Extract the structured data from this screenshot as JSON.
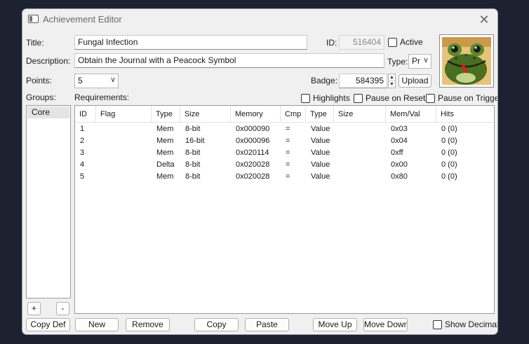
{
  "window": {
    "title": "Achievement Editor",
    "close_glyph": "✕"
  },
  "fields": {
    "title_label": "Title:",
    "title_value": "Fungal Infection",
    "id_label": "ID:",
    "id_value": "516404",
    "active_label": "Active",
    "description_label": "Description:",
    "description_value": "Obtain the Journal with a Peacock Symbol",
    "type_label": "Type:",
    "type_value": "Pr",
    "points_label": "Points:",
    "points_value": "5",
    "badge_label": "Badge:",
    "badge_value": "584395",
    "upload_label": "Upload"
  },
  "groups": {
    "label": "Groups:",
    "items": [
      "Core"
    ],
    "add_label": "+",
    "remove_label": "-"
  },
  "requirements": {
    "label": "Requirements:",
    "highlights_label": "Highlights",
    "pause_on_reset_label": "Pause on Reset",
    "pause_on_trigger_label": "Pause on Trigger",
    "columns": [
      "ID",
      "Flag",
      "Type",
      "Size",
      "Memory",
      "Cmp",
      "Type",
      "Size",
      "Mem/Val",
      "Hits"
    ],
    "rows": [
      [
        "1",
        "",
        "Mem",
        "8-bit",
        "0x000090",
        "=",
        "Value",
        "",
        "0x03",
        "0 (0)"
      ],
      [
        "2",
        "",
        "Mem",
        "16-bit",
        "0x000096",
        "=",
        "Value",
        "",
        "0x04",
        "0 (0)"
      ],
      [
        "3",
        "",
        "Mem",
        "8-bit",
        "0x020114",
        "=",
        "Value",
        "",
        "0xff",
        "0 (0)"
      ],
      [
        "4",
        "",
        "Delta",
        "8-bit",
        "0x020028",
        "=",
        "Value",
        "",
        "0x00",
        "0 (0)"
      ],
      [
        "5",
        "",
        "Mem",
        "8-bit",
        "0x020028",
        "=",
        "Value",
        "",
        "0x80",
        "0 (0)"
      ]
    ]
  },
  "buttons": {
    "copy_def": "Copy Def",
    "new": "New",
    "remove": "Remove",
    "copy": "Copy",
    "paste": "Paste",
    "move_up": "Move Up",
    "move_down": "Move Down",
    "show_decimal": "Show Decimal"
  },
  "colors": {
    "badge_frog_green": "#4a6e22",
    "badge_tongue": "#d82020"
  }
}
